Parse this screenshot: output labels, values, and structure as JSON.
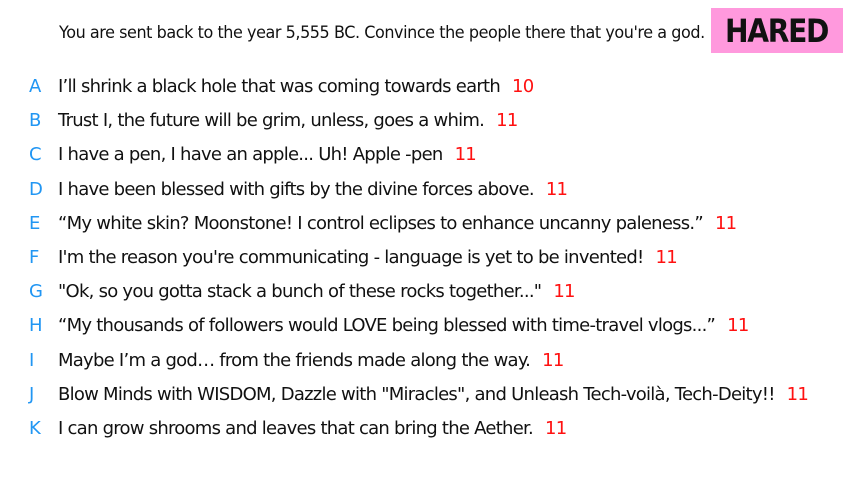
{
  "prompt": "You are sent back to the year 5,555 BC. Convince the people there that you're a god.",
  "badge": "HARED",
  "colors": {
    "letter": "#2196f3",
    "score": "#ff1111",
    "badge_bg": "#ff99dd"
  },
  "answers": [
    {
      "letter": "A",
      "text": "I’ll shrink a black hole that was coming towards earth",
      "score": "10"
    },
    {
      "letter": "B",
      "text": "Trust I, the future will be grim, unless, goes a whim.",
      "score": "11"
    },
    {
      "letter": "C",
      "text": "I have a pen, I have an apple... Uh! Apple -pen",
      "score": "11"
    },
    {
      "letter": "D",
      "text": "I have been blessed with gifts by the divine forces above.",
      "score": "11"
    },
    {
      "letter": "E",
      "text": "“My white skin? Moonstone! I control eclipses to enhance uncanny paleness.”",
      "score": "11"
    },
    {
      "letter": "F",
      "text": "I'm the reason you're communicating - language is yet to be invented!",
      "score": "11"
    },
    {
      "letter": "G",
      "text": "\"Ok, so you gotta stack a bunch of these rocks together...\"",
      "score": "11"
    },
    {
      "letter": "H",
      "text": "“My thousands of followers would LOVE being blessed with time-travel vlogs...”",
      "score": "11"
    },
    {
      "letter": "I",
      "text": "Maybe I’m a god… from the friends made along the way.",
      "score": "11"
    },
    {
      "letter": "J",
      "text": "Blow Minds with WISDOM, Dazzle with \"Miracles\", and Unleash Tech-voilà, Tech-Deity!!",
      "score": "11"
    },
    {
      "letter": "K",
      "text": "I can grow shrooms and leaves that can bring the Aether.",
      "score": "11"
    }
  ]
}
